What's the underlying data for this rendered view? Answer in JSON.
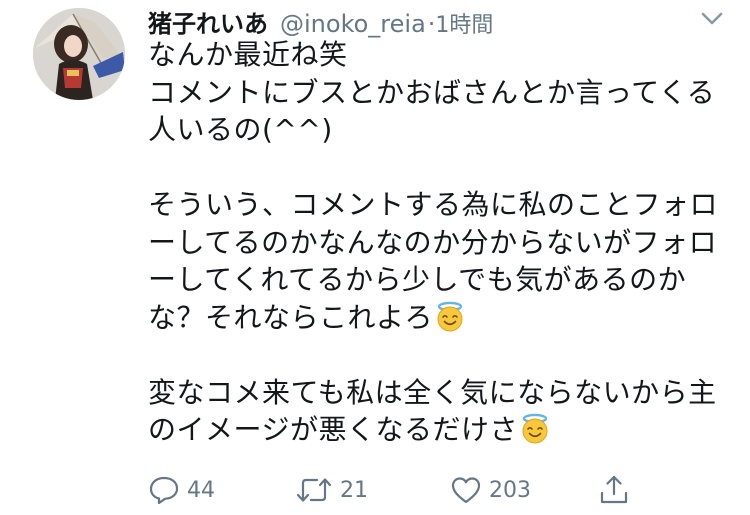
{
  "tweet": {
    "author": {
      "display_name": "猪子れいあ",
      "handle": "@inoko_reia",
      "separator": "·",
      "time": "1時間"
    },
    "lines": [
      "なんか最近ね笑",
      "コメントにブスとかおばさんとか言ってくる",
      "人いるの(^^)",
      "",
      "そういう、コメントする為に私のことフォロ",
      "ーしてるのかなんなのか分からないがフォロ",
      "ーしてくれてるから少しでも気があるのか",
      "な？それならこれよろ",
      "",
      "変なコメ来ても私は全く気にならないから主",
      "のイメージが悪くなるだけさ"
    ],
    "emojis": [
      "smiling-face-with-halo",
      "smiling-face-with-halo"
    ],
    "actions": {
      "reply_count": "44",
      "retweet_count": "21",
      "like_count": "203"
    }
  },
  "colors": {
    "text": "#14171a",
    "secondary": "#657786",
    "emoji_face": "#f9c83a",
    "emoji_halo": "#63b4e8"
  },
  "icons": [
    "avatar",
    "chevron-down-icon",
    "reply-icon",
    "retweet-icon",
    "like-icon",
    "share-icon",
    "halo-emoji-icon"
  ]
}
